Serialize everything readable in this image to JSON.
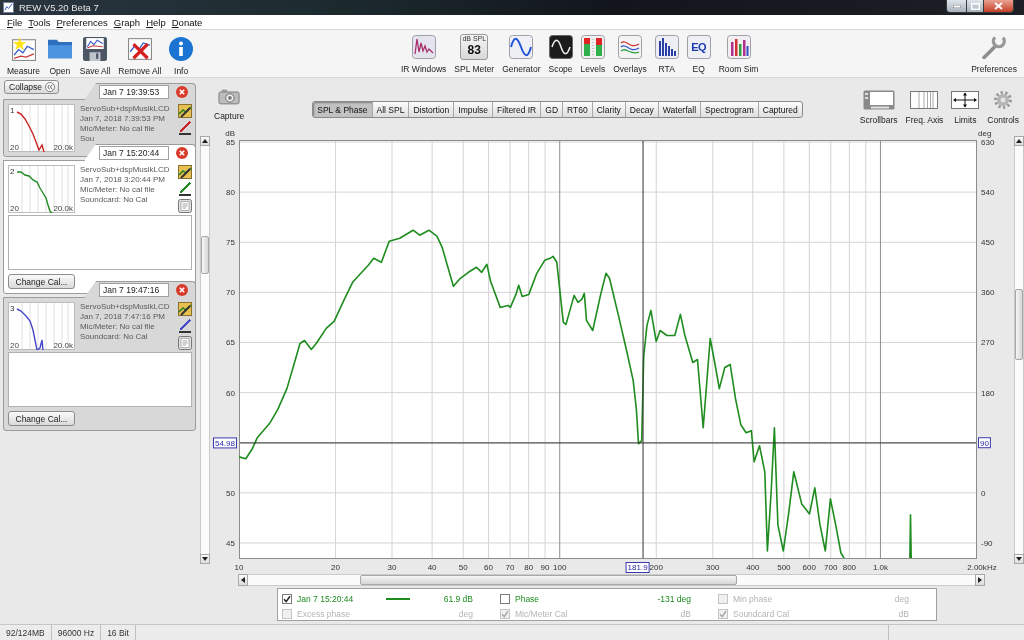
{
  "window": {
    "title": "REW V5.20 Beta 7"
  },
  "menu": [
    "File",
    "Tools",
    "Preferences",
    "Graph",
    "Help",
    "Donate"
  ],
  "toolbar": {
    "left": [
      {
        "label": "Measure"
      },
      {
        "label": "Open"
      },
      {
        "label": "Save All"
      },
      {
        "label": "Remove All"
      },
      {
        "label": "Info"
      }
    ],
    "middle": [
      {
        "label": "IR Windows"
      },
      {
        "label": "SPL Meter",
        "icon_caption": "dB SPL",
        "icon_reading": "83"
      },
      {
        "label": "Generator"
      },
      {
        "label": "Scope"
      },
      {
        "label": "Levels"
      },
      {
        "label": "Overlays"
      },
      {
        "label": "RTA"
      },
      {
        "label": "EQ",
        "icon_text": "EQ"
      },
      {
        "label": "Room Sim"
      }
    ],
    "right": [
      {
        "label": "Preferences"
      }
    ]
  },
  "measurements": {
    "collapse_button": "Collapse",
    "items": [
      {
        "name": "Jan 7 19:39:53",
        "index": "1",
        "color": "#cc2222",
        "selected": false,
        "expanded": false,
        "thumb_labels": [
          "20",
          "20.0k"
        ],
        "lines": [
          "ServoSub+dspMusikLCD",
          "Jan 7, 2018 7:39:53 PM",
          "Mic/Meter: No cal file",
          "Sou"
        ]
      },
      {
        "name": "Jan 7 15:20:44",
        "index": "2",
        "color": "#1e8c1e",
        "selected": true,
        "expanded": true,
        "thumb_labels": [
          "20",
          "20.0k"
        ],
        "lines": [
          "ServoSub+dspMusikLCD",
          "Jan 7, 2018 3:20:44 PM",
          "Mic/Meter: No cal file",
          "Soundcard: No Cal"
        ],
        "button": "Change Cal..."
      },
      {
        "name": "Jan 7 19:47:16",
        "index": "3",
        "color": "#4646c8",
        "selected": false,
        "expanded": true,
        "thumb_labels": [
          "20",
          "20.0k"
        ],
        "lines": [
          "ServoSub+dspMusikLCD",
          "Jan 7, 2018 7:47:16 PM",
          "Mic/Meter: No cal file",
          "Soundcard: No Cal"
        ],
        "button": "Change Cal..."
      }
    ]
  },
  "graph": {
    "capture": "Capture",
    "tabs": [
      {
        "label": "SPL & Phase",
        "selected": true
      },
      {
        "label": "All SPL",
        "selected": false
      },
      {
        "label": "Distortion",
        "selected": false
      },
      {
        "label": "Impulse",
        "selected": false
      },
      {
        "label": "Filtered IR",
        "selected": false
      },
      {
        "label": "GD",
        "selected": false
      },
      {
        "label": "RT60",
        "selected": false
      },
      {
        "label": "Clarity",
        "selected": false
      },
      {
        "label": "Decay",
        "selected": false
      },
      {
        "label": "Waterfall",
        "selected": false
      },
      {
        "label": "Spectrogram",
        "selected": false
      },
      {
        "label": "Captured",
        "selected": false
      }
    ],
    "controls": [
      {
        "label": "Scrollbars"
      },
      {
        "label": "Freq. Axis"
      },
      {
        "label": "Limits"
      },
      {
        "label": "Controls"
      }
    ],
    "chart_data": {
      "type": "line",
      "xlabel": "Hz",
      "ylabel": "dB",
      "log": "x",
      "grid": true,
      "x": [
        10,
        10.5,
        11,
        11.4,
        12.5,
        13.2,
        14.1,
        14.9,
        15.5,
        16,
        16.8,
        17.4,
        18.7,
        19.8,
        21.3,
        22.6,
        25.3,
        26.3,
        27.8,
        29.4,
        31.7,
        34.9,
        36.6,
        39.1,
        41.4,
        43,
        44.6,
        46.6,
        49,
        51.9,
        55,
        57.1,
        59.3,
        60.9,
        65.2,
        69,
        70.2,
        73,
        74.5,
        76.4,
        80.1,
        84.8,
        89.8,
        93.3,
        95.3,
        97.9,
        102.6,
        104.6,
        110.9,
        114,
        117.2,
        119.3,
        121.2,
        126.7,
        134.2,
        139.4,
        143,
        152.9,
        161.9,
        169.5,
        173.4,
        176,
        180.1,
        182.8,
        187.1,
        192.4,
        199.9,
        205.5,
        216,
        228.5,
        237.8,
        245.6,
        259.9,
        268.9,
        280.1,
        294.5,
        306.3,
        314.5,
        327,
        340,
        353.1,
        366.8,
        381.2,
        395.8,
        403.7,
        419.5,
        436,
        444,
        456,
        467,
        479,
        498,
        517,
        537,
        568,
        601,
        624,
        648,
        673,
        698,
        725,
        753,
        770,
        1235,
        1241,
        1247
      ],
      "series": [
        {
          "name": "Jan 7 15:20:44",
          "color": "#1e8c1e",
          "values": [
            53.6,
            53.4,
            54.4,
            55.5,
            57.0,
            58.3,
            60.4,
            63.0,
            64.9,
            65.2,
            64.3,
            64.9,
            66.4,
            67.1,
            69.3,
            71.0,
            72.7,
            73.4,
            73.0,
            75.1,
            75.4,
            76.2,
            75.7,
            76.2,
            75.6,
            74.5,
            72.7,
            70.6,
            71.4,
            72.0,
            72.5,
            72.0,
            72.8,
            71.1,
            68.5,
            68.7,
            68.5,
            69.8,
            70.7,
            69.6,
            69.8,
            71.9,
            73.2,
            73.4,
            73.6,
            73.0,
            67.0,
            66.8,
            69.7,
            69.0,
            69.3,
            69.9,
            67.2,
            66.2,
            69.8,
            71.9,
            71.4,
            67.5,
            64.1,
            61.2,
            58.3,
            54.9,
            55.2,
            63.6,
            66.7,
            68.2,
            65.1,
            66.2,
            65.7,
            65.7,
            67.8,
            65.7,
            63.0,
            63.3,
            56.5,
            65.4,
            62.5,
            60.4,
            62.5,
            62.8,
            59.4,
            56.8,
            56.0,
            56.2,
            53.1,
            54.7,
            52.1,
            44.2,
            50.0,
            56.5,
            46.8,
            44.2,
            47.9,
            52.1,
            48.9,
            47.9,
            50.5,
            46.8,
            44.2,
            49.4,
            46.8,
            44.0,
            43.5,
            43.5,
            47.8,
            43.5
          ]
        }
      ],
      "xlim": [
        10,
        2000
      ],
      "ylim": [
        43.4,
        85.2
      ],
      "xticks": [
        10,
        20,
        30,
        40,
        50,
        60,
        70,
        80,
        90,
        100,
        200,
        300,
        400,
        500,
        600,
        700,
        800,
        {
          "value": 1000,
          "label": "1.0k"
        },
        {
          "value": 2000,
          "label": "2.00k"
        }
      ],
      "yticks": [
        45,
        50,
        60,
        65,
        70,
        75,
        80,
        85
      ],
      "y2label": "deg",
      "y2lim": [
        -118.8,
        633.6
      ],
      "y2ticks": [
        -90,
        0,
        90,
        180,
        270,
        360,
        450,
        540,
        630
      ],
      "ref_lines": [
        {
          "axis": "x",
          "value": 181.9,
          "label": "181.9"
        },
        {
          "axis": "y",
          "value": 54.98,
          "label": "54.98"
        }
      ]
    },
    "legend": [
      {
        "kind": "trace",
        "checked": true,
        "disabled": false,
        "reading": "61.9 dB"
      },
      {
        "kind": "option",
        "label": "Phase",
        "checked": false,
        "disabled": false,
        "reading": "-131 deg"
      },
      {
        "kind": "option",
        "label": "Min phase",
        "checked": false,
        "disabled": true,
        "reading": "deg"
      },
      {
        "kind": "option",
        "label": "Excess phase",
        "checked": false,
        "disabled": true,
        "reading": "deg"
      },
      {
        "kind": "option",
        "label": "Mic/Meter Cal",
        "checked": true,
        "disabled": true,
        "reading": "dB"
      },
      {
        "kind": "option",
        "label": "Soundcard Cal",
        "checked": true,
        "disabled": true,
        "reading": "dB"
      }
    ]
  },
  "status_bar": [
    "92/124MB",
    "96000 Hz",
    "16 Bit"
  ]
}
